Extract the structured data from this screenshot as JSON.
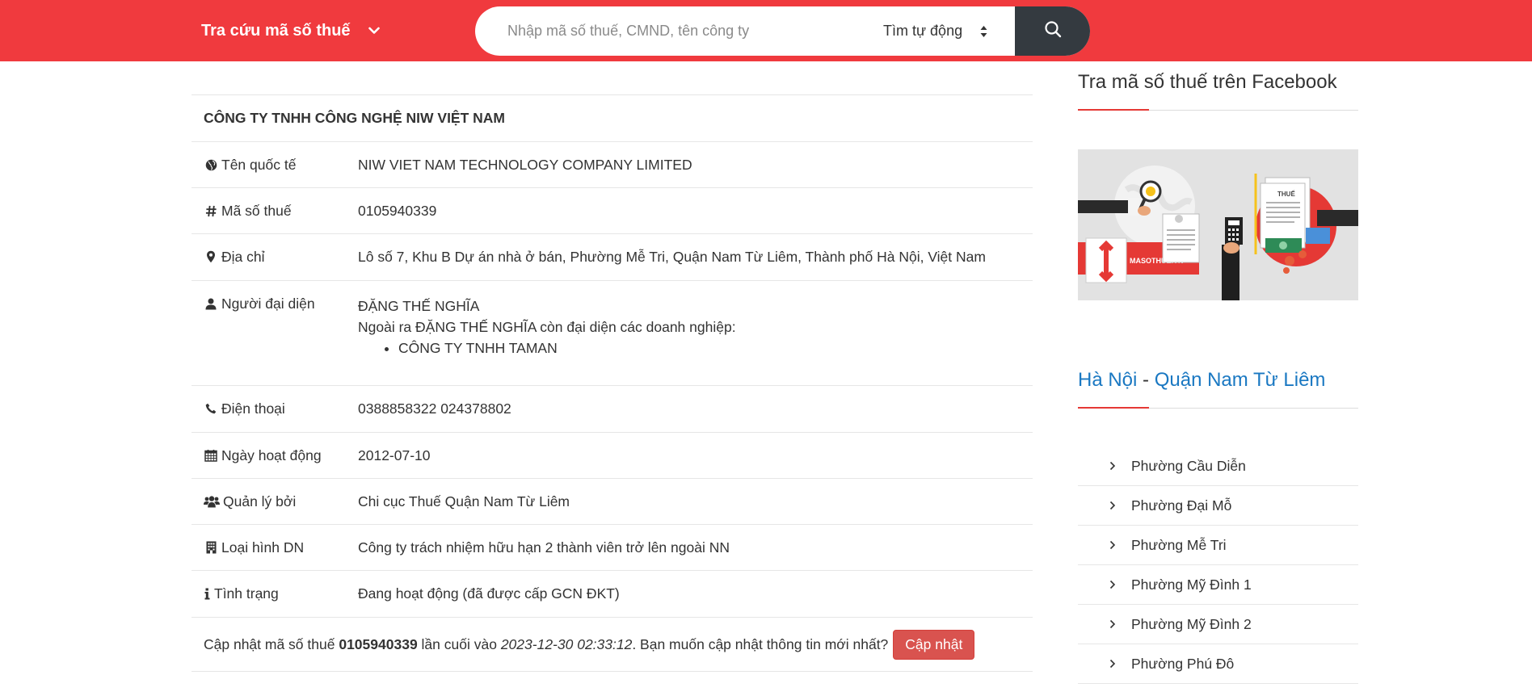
{
  "header": {
    "brand_label": "Tra cứu mã số thuế",
    "search_placeholder": "Nhập mã số thuế, CMND, tên công ty",
    "mode_select_value": "Tìm tự động",
    "search_icon": "search-icon",
    "brand_color": "#f03a3e"
  },
  "company": {
    "name": "CÔNG TY TNHH CÔNG NGHỆ NIW VIỆT NAM",
    "rows": {
      "intl_name": {
        "label": "Tên quốc tế",
        "value": "NIW VIET NAM TECHNOLOGY COMPANY LIMITED",
        "icon": "globe-icon"
      },
      "tax_code": {
        "label": "Mã số thuế",
        "value": "0105940339",
        "icon": "hash-icon"
      },
      "address": {
        "label": "Địa chỉ",
        "value": "Lô số 7, Khu B Dự án nhà ở bán, Phường Mễ Tri, Quận Nam Từ Liêm, Thành phố Hà Nội, Việt Nam",
        "icon": "map-marker-icon"
      },
      "representative": {
        "label": "Người đại diện",
        "value": "ĐẶNG THẾ NGHĨA",
        "note": "Ngoài ra ĐẶNG THẾ NGHĨA còn đại diện các doanh nghiệp:",
        "others": [
          "CÔNG TY TNHH TAMAN"
        ],
        "icon": "user-icon"
      },
      "phone": {
        "label": "Điện thoại",
        "value": "0388858322 024378802",
        "icon": "phone-icon"
      },
      "start_date": {
        "label": "Ngày hoạt động",
        "value": "2012-07-10",
        "icon": "calendar-icon"
      },
      "managed_by": {
        "label": "Quản lý bởi",
        "value": "Chi cục Thuế Quận Nam Từ Liêm",
        "icon": "users-icon"
      },
      "biz_type": {
        "label": "Loại hình DN",
        "value": "Công ty trách nhiệm hữu hạn 2 thành viên trở lên ngoài NN",
        "icon": "building-icon"
      },
      "status": {
        "label": "Tình trạng",
        "value": "Đang hoạt động (đã được cấp GCN ĐKT)",
        "icon": "info-icon"
      }
    },
    "update": {
      "prefix": "Cập nhật mã số thuế",
      "tax_code": "0105940339",
      "middle": "lần cuối vào",
      "datetime": "2023-12-30 02:33:12",
      "question": ". Bạn muốn cập nhật thông tin mới nhất?",
      "button_label": "Cập nhật"
    }
  },
  "sidebar": {
    "facebook_title": "Tra mã số thuế trên Facebook",
    "banner_text": "MASOTHUE.VN",
    "banner_doc_text": "THUẾ",
    "region": {
      "city": "Hà Nội",
      "separator": "-",
      "district": "Quận Nam Từ Liêm"
    },
    "wards": [
      "Phường Cầu Diễn",
      "Phường Đại Mỗ",
      "Phường Mễ Tri",
      "Phường Mỹ Đình 1",
      "Phường Mỹ Đình 2",
      "Phường Phú Đô"
    ]
  }
}
